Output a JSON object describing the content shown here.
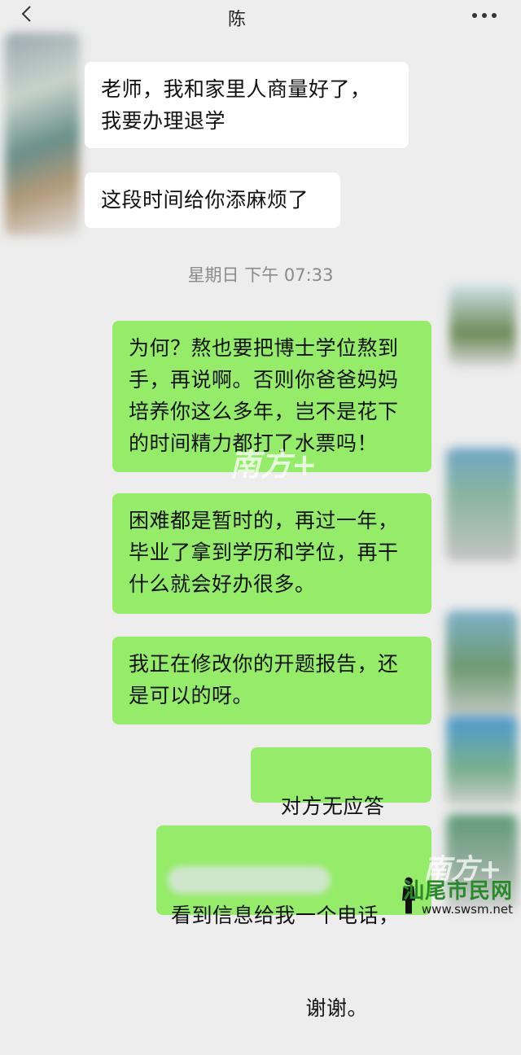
{
  "header": {
    "contact_name": "陈",
    "back_icon": "chevron-left-icon",
    "more_icon": "more-dots-icon"
  },
  "messages": {
    "m1": "老师，我和家里人商量好了，\n我要办理退学",
    "m2": "这段时间给你添麻烦了",
    "timestamp": "星期日 下午 07:33",
    "m3": "为何？熬也要把博士学位熬到\n手，再说啊。否则你爸爸妈妈\n培养你这么多年，岂不是花下\n的时间精力都打了水票吗！",
    "m4": "困难都是暂时的，再过一年，\n毕业了拿到学历和学位，再干\n什么就会好办很多。",
    "m5": "我正在修改你的开题报告，还\n是可以的呀。",
    "m6": "对方无应答",
    "m7_line1": "看到信息给我一个电话，",
    "m7_line2": "谢谢。"
  },
  "watermarks": {
    "nanfang": "南方+",
    "site_name": "汕尾市民网",
    "site_url": "www.swsm.net"
  },
  "colors": {
    "background": "#ededed",
    "incoming_bubble": "#ffffff",
    "outgoing_bubble": "#95ec69"
  }
}
